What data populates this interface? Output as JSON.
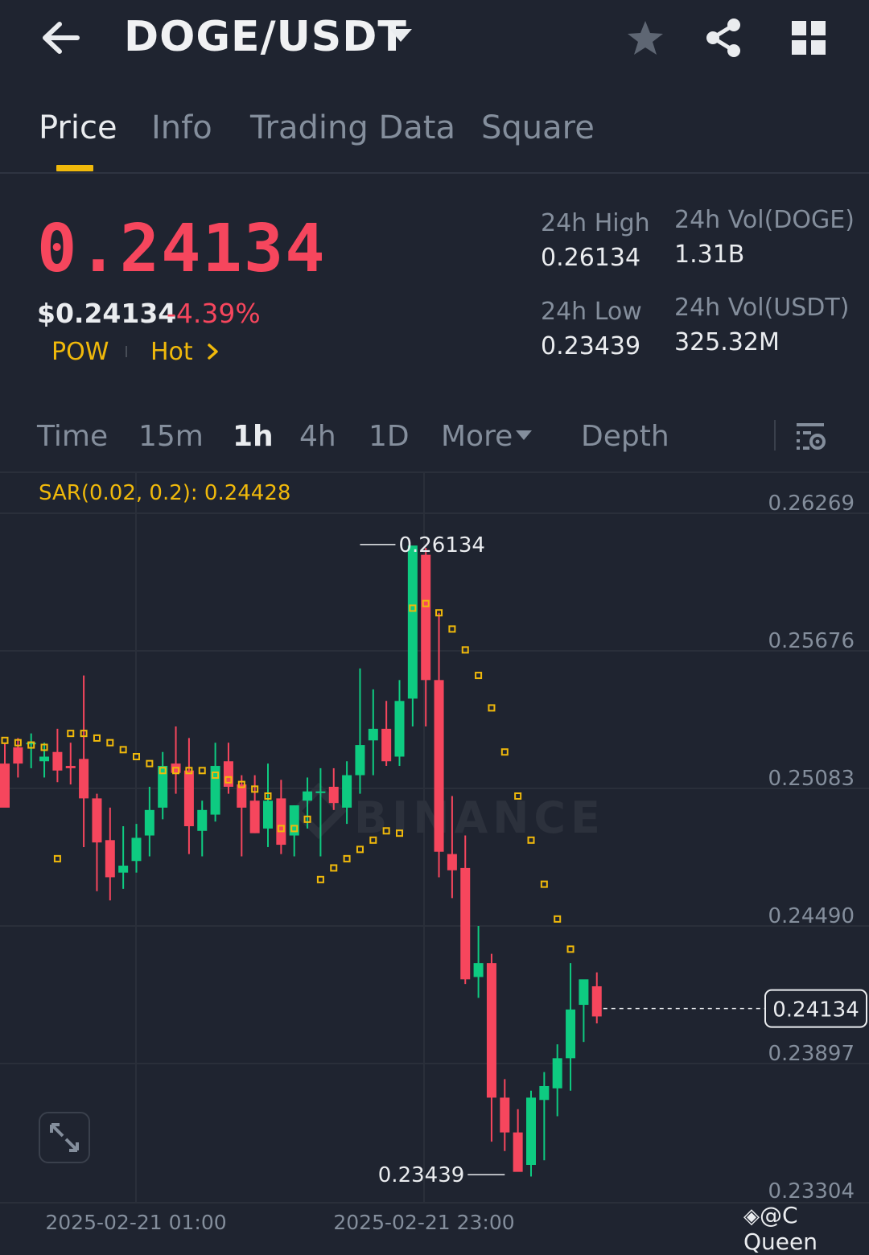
{
  "header": {
    "title": "DOGE/USDT",
    "icons": [
      "arrow-left-icon",
      "caret-down-icon",
      "star-icon",
      "share-icon",
      "grid-icon"
    ]
  },
  "tabs": [
    {
      "label": "Price",
      "active": true
    },
    {
      "label": "Info",
      "active": false
    },
    {
      "label": "Trading Data",
      "active": false
    },
    {
      "label": "Square",
      "active": false
    }
  ],
  "price": {
    "last": "0.24134",
    "usd": "$0.24134",
    "change": "-4.39%",
    "tags": [
      "POW",
      "Hot"
    ]
  },
  "stats": {
    "high_label": "24h High",
    "high": "0.26134",
    "low_label": "24h Low",
    "low": "0.23439",
    "vol_base_label": "24h Vol(DOGE)",
    "vol_base": "1.31B",
    "vol_quote_label": "24h Vol(USDT)",
    "vol_quote": "325.32M"
  },
  "timeframes": [
    "Time",
    "15m",
    "1h",
    "4h",
    "1D",
    "More",
    "Depth"
  ],
  "active_timeframe": "1h",
  "colors": {
    "up": "#0ecb81",
    "down": "#f6465d",
    "accent": "#f0b90b",
    "bg": "#1f2430"
  },
  "chart": {
    "indicator": "SAR(0.02, 0.2): 0.24428",
    "brand_watermark": "BINANCE",
    "y_ticks": [
      "0.26269",
      "0.25676",
      "0.25083",
      "0.24490",
      "0.23897",
      "0.23304"
    ],
    "y_tick_values": [
      0.26269,
      0.25676,
      0.25083,
      0.2449,
      0.23897,
      0.23304
    ],
    "x_labels": [
      "2025-02-21 01:00",
      "2025-02-21 23:00"
    ],
    "high_marker": "0.26134",
    "low_marker": "0.23439",
    "last_price_tag": "0.24134",
    "candles": [
      [
        0.2519,
        0.2528,
        0.2502,
        0.25
      ],
      [
        0.2526,
        0.253,
        0.2513,
        0.2519
      ],
      [
        0.2528,
        0.2532,
        0.2517,
        0.2528
      ],
      [
        0.252,
        0.2528,
        0.2513,
        0.2522
      ],
      [
        0.2524,
        0.2534,
        0.2511,
        0.2516
      ],
      [
        0.2518,
        0.2528,
        0.251,
        0.2517
      ],
      [
        0.2521,
        0.2557,
        0.2483,
        0.2504
      ],
      [
        0.2504,
        0.2506,
        0.2464,
        0.2485
      ],
      [
        0.2486,
        0.25,
        0.246,
        0.247
      ],
      [
        0.2472,
        0.2492,
        0.2465,
        0.2475
      ],
      [
        0.2477,
        0.2493,
        0.2472,
        0.2487
      ],
      [
        0.2488,
        0.2509,
        0.2479,
        0.2499
      ],
      [
        0.25,
        0.2524,
        0.2495,
        0.2518
      ],
      [
        0.2519,
        0.2535,
        0.2506,
        0.2515
      ],
      [
        0.2516,
        0.253,
        0.248,
        0.2492
      ],
      [
        0.249,
        0.2503,
        0.2479,
        0.2499
      ],
      [
        0.2497,
        0.2528,
        0.2494,
        0.2518
      ],
      [
        0.252,
        0.2528,
        0.2506,
        0.2509
      ],
      [
        0.251,
        0.2514,
        0.2479,
        0.25
      ],
      [
        0.2503,
        0.2514,
        0.2489,
        0.2489
      ],
      [
        0.2491,
        0.2519,
        0.2483,
        0.2503
      ],
      [
        0.2504,
        0.2512,
        0.248,
        0.2484
      ],
      [
        0.2488,
        0.2501,
        0.2479,
        0.2501
      ],
      [
        0.2503,
        0.2513,
        0.2491,
        0.2507
      ],
      [
        0.2507,
        0.2517,
        0.2479,
        0.2507
      ],
      [
        0.2509,
        0.2517,
        0.2499,
        0.2502
      ],
      [
        0.25,
        0.252,
        0.2493,
        0.2514
      ],
      [
        0.2514,
        0.256,
        0.2506,
        0.2527
      ],
      [
        0.2529,
        0.2551,
        0.2514,
        0.2534
      ],
      [
        0.2534,
        0.2546,
        0.2518,
        0.252
      ],
      [
        0.2522,
        0.2555,
        0.2518,
        0.2546
      ],
      [
        0.2547,
        0.26,
        0.2535,
        0.2613
      ],
      [
        0.2609,
        0.2612,
        0.2535,
        0.2555
      ],
      [
        0.2555,
        0.2584,
        0.247,
        0.2481
      ],
      [
        0.248,
        0.2505,
        0.2461,
        0.2473
      ],
      [
        0.2474,
        0.2488,
        0.2424,
        0.2426
      ],
      [
        0.2427,
        0.2449,
        0.2418,
        0.2433
      ],
      [
        0.2433,
        0.2437,
        0.2356,
        0.2375
      ],
      [
        0.2375,
        0.2383,
        0.2352,
        0.236
      ],
      [
        0.236,
        0.237,
        0.2344,
        0.2343
      ],
      [
        0.2346,
        0.2378,
        0.2341,
        0.2375
      ],
      [
        0.2374,
        0.2386,
        0.2348,
        0.238
      ],
      [
        0.2379,
        0.2398,
        0.2367,
        0.2392
      ],
      [
        0.2392,
        0.2433,
        0.2378,
        0.2413
      ],
      [
        0.2415,
        0.2421,
        0.2399,
        0.2426
      ],
      [
        0.2423,
        0.2429,
        0.2407,
        0.241
      ]
    ],
    "sar": [
      [
        0,
        0.2529
      ],
      [
        1,
        0.2528
      ],
      [
        2,
        0.2527
      ],
      [
        3,
        0.2526
      ],
      [
        5,
        0.2532
      ],
      [
        6,
        0.2532
      ],
      [
        7,
        0.253
      ],
      [
        8,
        0.2528
      ],
      [
        9,
        0.2525
      ],
      [
        10,
        0.2522
      ],
      [
        11,
        0.2519
      ],
      [
        12,
        0.2516
      ],
      [
        13,
        0.2516
      ],
      [
        14,
        0.2516
      ],
      [
        15,
        0.2516
      ],
      [
        16,
        0.2514
      ],
      [
        17,
        0.2512
      ],
      [
        18,
        0.251
      ],
      [
        19,
        0.2508
      ],
      [
        20,
        0.2505
      ],
      [
        4,
        0.2478
      ],
      [
        21,
        0.2491
      ],
      [
        22,
        0.2491
      ],
      [
        23,
        0.2495
      ],
      [
        24,
        0.2469
      ],
      [
        25,
        0.2474
      ],
      [
        26,
        0.2478
      ],
      [
        27,
        0.2482
      ],
      [
        28,
        0.2486
      ],
      [
        29,
        0.249
      ],
      [
        30,
        0.2489
      ],
      [
        31,
        0.2586
      ],
      [
        32,
        0.2588
      ],
      [
        33,
        0.2584
      ],
      [
        34,
        0.2577
      ],
      [
        35,
        0.2568
      ],
      [
        36,
        0.2557
      ],
      [
        37,
        0.2543
      ],
      [
        38,
        0.2524
      ],
      [
        39,
        0.2505
      ],
      [
        40,
        0.2486
      ],
      [
        41,
        0.2467
      ],
      [
        42,
        0.2452
      ],
      [
        43,
        0.2439
      ]
    ]
  }
}
